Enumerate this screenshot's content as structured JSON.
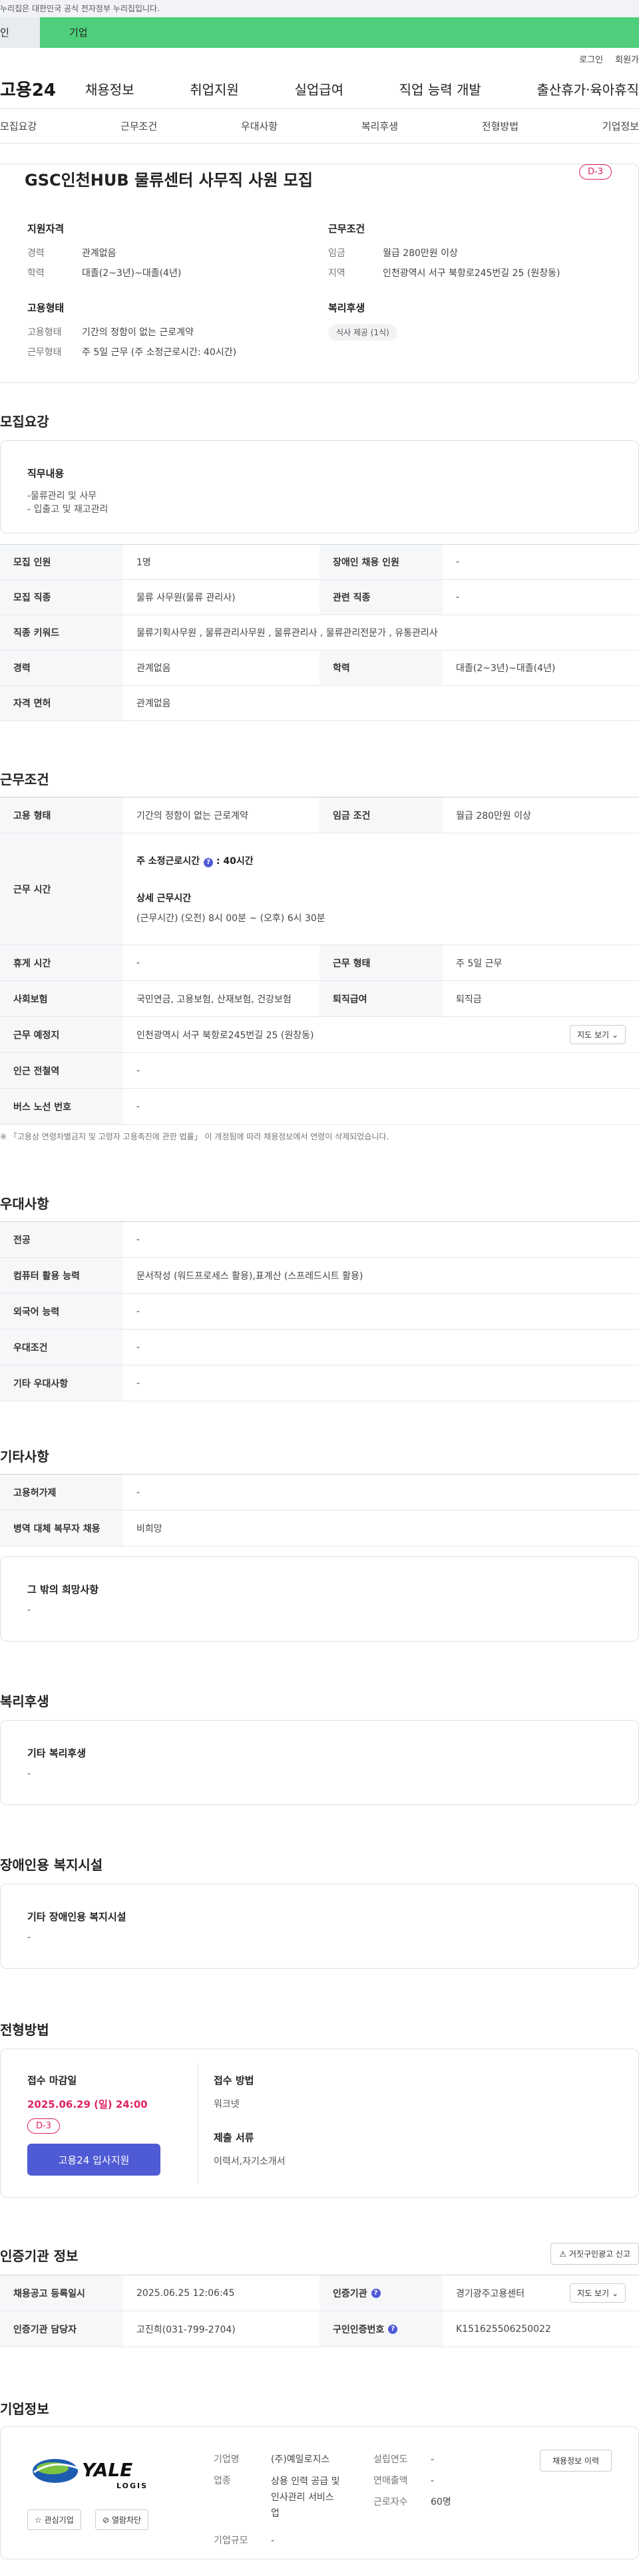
{
  "topbar": {
    "notice": "누리집은 대한민국 공식 전자정부 누리집입니다."
  },
  "tabs": {
    "personal": "인",
    "company": "기업"
  },
  "util": {
    "login": "로그인",
    "join": "회원가"
  },
  "gnb": {
    "logo": "고용24",
    "items": [
      "채용정보",
      "취업지원",
      "실업급여",
      "직업 능력 개발",
      "출산휴가·육아휴직"
    ]
  },
  "subnav": {
    "items": [
      "모집요강",
      "근무조건",
      "우대사항",
      "복리후생",
      "전형방법",
      "기업정보"
    ]
  },
  "summary": {
    "title": "GSC인천HUB 물류센터 사무직 사원 모집",
    "dday": "D-3",
    "qualification": {
      "label": "지원자격",
      "career_k": "경력",
      "career_v": "관계없음",
      "edu_k": "학력",
      "edu_v": "대졸(2~3년)~대졸(4년)"
    },
    "conditions": {
      "label": "근무조건",
      "wage_k": "임금",
      "wage_v": "월급 280만원 이상",
      "area_k": "지역",
      "area_v": "인천광역시 서구 북항로245번길 25 (원창동)"
    },
    "employment": {
      "label": "고용형태",
      "type_k": "고용형태",
      "type_v": "기간의 정함이 없는 근로계약",
      "shape_k": "근무형태",
      "shape_v": "주 5일 근무 (주 소정근로시간: 40시간)"
    },
    "welfare": {
      "label": "복리후생",
      "tag": "식사 제공 (1식)"
    }
  },
  "recruit": {
    "title": "모집요강",
    "job_label": "직무내용",
    "job_lines": [
      "-물류관리 및 사무",
      "- 입출고 및 재고관리"
    ],
    "rows": [
      {
        "k1": "모집 인원",
        "v1": "1명",
        "k2": "장애인 채용 인원",
        "v2": "-"
      },
      {
        "k1": "모집 직종",
        "v1": "물류 사무원(물류 관리사)",
        "k2": "관련 직종",
        "v2": "-"
      },
      {
        "k1": "직종 키워드",
        "v1": "물류기획사무원 , 물류관리사무원 , 물류관리사 , 물류관리전문가 , 유통관리사"
      },
      {
        "k1": "경력",
        "v1": "관계없음",
        "k2": "학력",
        "v2": "대졸(2~3년)~대졸(4년)"
      },
      {
        "k1": "자격 면허",
        "v1": "관계없음"
      }
    ]
  },
  "work": {
    "title": "근무조건",
    "r1": {
      "k1": "고용 형태",
      "v1": "기간의 정함이 없는 근로계약",
      "k2": "임금 조건",
      "v2": "월급 280만원 이상"
    },
    "r2": {
      "k": "근무 시간",
      "hours_label": "주 소정근로시간",
      "hours_value": ": 40시간",
      "detail_label": "상세 근무시간",
      "detail_value": "(근무시간) (오전) 8시 00분 ~ (오후) 6시 30분"
    },
    "r3": {
      "k1": "휴게 시간",
      "v1": "-",
      "k2": "근무 형태",
      "v2": "주 5일 근무"
    },
    "r4": {
      "k1": "사회보험",
      "v1": "국민연금, 고용보험, 산재보험, 건강보험",
      "k2": "퇴직급여",
      "v2": "퇴직금"
    },
    "r5": {
      "k": "근무 예정지",
      "v": "인천광역시 서구 북항로245번길 25 (원창동)",
      "btn": "지도 보기"
    },
    "r6": {
      "k": "인근 전철역",
      "v": "-"
    },
    "r7": {
      "k": "버스 노선 번호",
      "v": "-"
    },
    "note": "※ 「고용상 연령차별금지 및 고령자 고용촉진에 관한 법률」 이 개정됨에 따라 채용정보에서 연령이 삭제되었습니다."
  },
  "prefer": {
    "title": "우대사항",
    "rows": [
      {
        "k": "전공",
        "v": "-"
      },
      {
        "k": "컴퓨터 활용 능력",
        "v": "문서작성 (워드프로세스 활용),표계산 (스프레드시트 활용)"
      },
      {
        "k": "외국어 능력",
        "v": "-"
      },
      {
        "k": "우대조건",
        "v": "-"
      },
      {
        "k": "기타 우대사항",
        "v": "-"
      }
    ]
  },
  "etc": {
    "title": "기타사항",
    "rows": [
      {
        "k": "고용허가제",
        "v": "-"
      },
      {
        "k": "병역 대체 복무자 채용",
        "v": "비희망"
      }
    ],
    "box_label": "그 밖의 희망사항",
    "box_value": "-"
  },
  "welfare": {
    "title": "복리후생",
    "box_label": "기타 복리후생",
    "box_value": "-"
  },
  "disabled": {
    "title": "장애인용 복지시설",
    "box_label": "기타 장애인용 복지시설",
    "box_value": "-"
  },
  "process": {
    "title": "전형방법",
    "deadline_label": "접수 마감일",
    "deadline_value": "2025.06.29 (일) 24:00",
    "dday": "D-3",
    "apply_btn": "고용24 입사지원",
    "method_label": "접수 방법",
    "method_value": "워크넷",
    "docs_label": "제출 서류",
    "docs_value": "이력서,자기소개서"
  },
  "cert": {
    "title": "인증기관 정보",
    "report_btn": "거짓구인광고 신고",
    "r1": {
      "k1": "채용공고 등록일시",
      "v1": "2025.06.25 12:06:45",
      "k2": "인증기관",
      "v2": "경기광주고용센터",
      "btn": "지도 보기"
    },
    "r2": {
      "k1": "인증기관 담당자",
      "v1": "고진희(031-799-2704)",
      "k2": "구인인증번호",
      "v2": "K151625506250022"
    }
  },
  "company": {
    "title": "기업정보",
    "logo_text": "YALE",
    "logo_sub": "LOGIS",
    "fav_btn": "관심기업",
    "block_btn": "열람차단",
    "name_k": "기업명",
    "name_v": "(주)예일로지스",
    "biz_k": "업종",
    "biz_v_lines": [
      "상용 인력 공급 및",
      "인사관리 서비스",
      "업"
    ],
    "size_k": "기업규모",
    "size_v": "-",
    "est_k": "설립연도",
    "est_v": "-",
    "sales_k": "연매출액",
    "sales_v": "-",
    "emp_k": "근로자수",
    "emp_v": "60명",
    "history_btn": "채용정보 이력"
  },
  "colors": {
    "accent": "#4f5bd5",
    "company_tab": "#4fcf7b",
    "dday": "#e0245e"
  }
}
